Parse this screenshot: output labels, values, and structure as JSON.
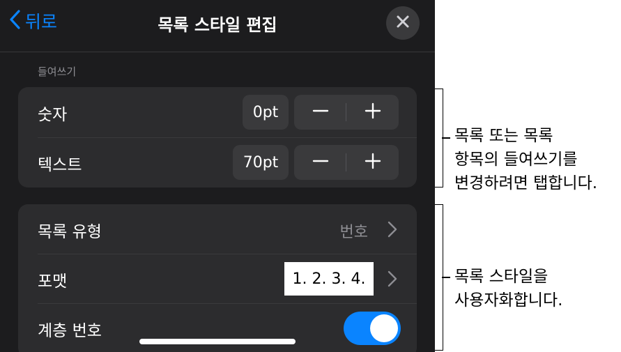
{
  "nav": {
    "back_label": "뒤로",
    "title": "목록 스타일 편집"
  },
  "indent": {
    "header": "들여쓰기",
    "rows": [
      {
        "label": "숫자",
        "value": "0pt"
      },
      {
        "label": "텍스트",
        "value": "70pt"
      }
    ]
  },
  "style": {
    "rows": [
      {
        "label": "목록 유형",
        "value": "번호"
      },
      {
        "label": "포맷",
        "value": "1. 2. 3. 4."
      },
      {
        "label": "계층 번호",
        "toggle_on": true
      }
    ]
  },
  "callouts": [
    {
      "lines": [
        "목록 또는 목록",
        "항목의 들여쓰기를",
        "변경하려면 탭합니다."
      ]
    },
    {
      "lines": [
        "목록 스타일을",
        "사용자화합니다."
      ]
    }
  ],
  "colors": {
    "accent": "#0a84ff",
    "panel_bg": "#1c1c1e",
    "group_bg": "#2c2c2e"
  }
}
